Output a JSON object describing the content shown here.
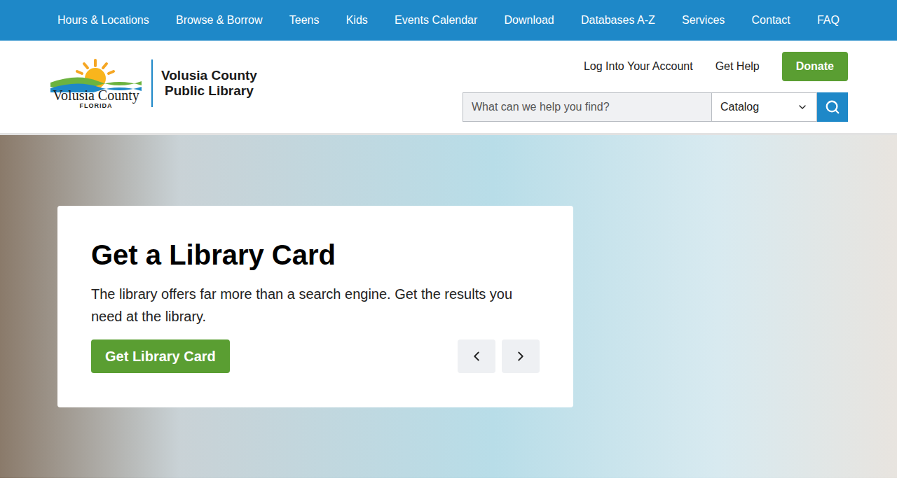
{
  "top_nav": {
    "items": [
      "Hours & Locations",
      "Browse & Borrow",
      "Teens",
      "Kids",
      "Events Calendar",
      "Download",
      "Databases A-Z",
      "Services",
      "Contact",
      "FAQ"
    ]
  },
  "logo": {
    "county": "Volusia County",
    "state": "FLORIDA",
    "library_line1": "Volusia County",
    "library_line2": "Public Library"
  },
  "header_links": [
    "Log Into Your Account",
    "Get Help"
  ],
  "donate_button": "Donate",
  "search": {
    "placeholder": "What can we help you find?",
    "scope": "Catalog"
  },
  "hero": {
    "title": "Get a Library Card",
    "text": "The library offers far more than a search engine. Get the results you need at the library.",
    "button": "Get Library Card"
  }
}
